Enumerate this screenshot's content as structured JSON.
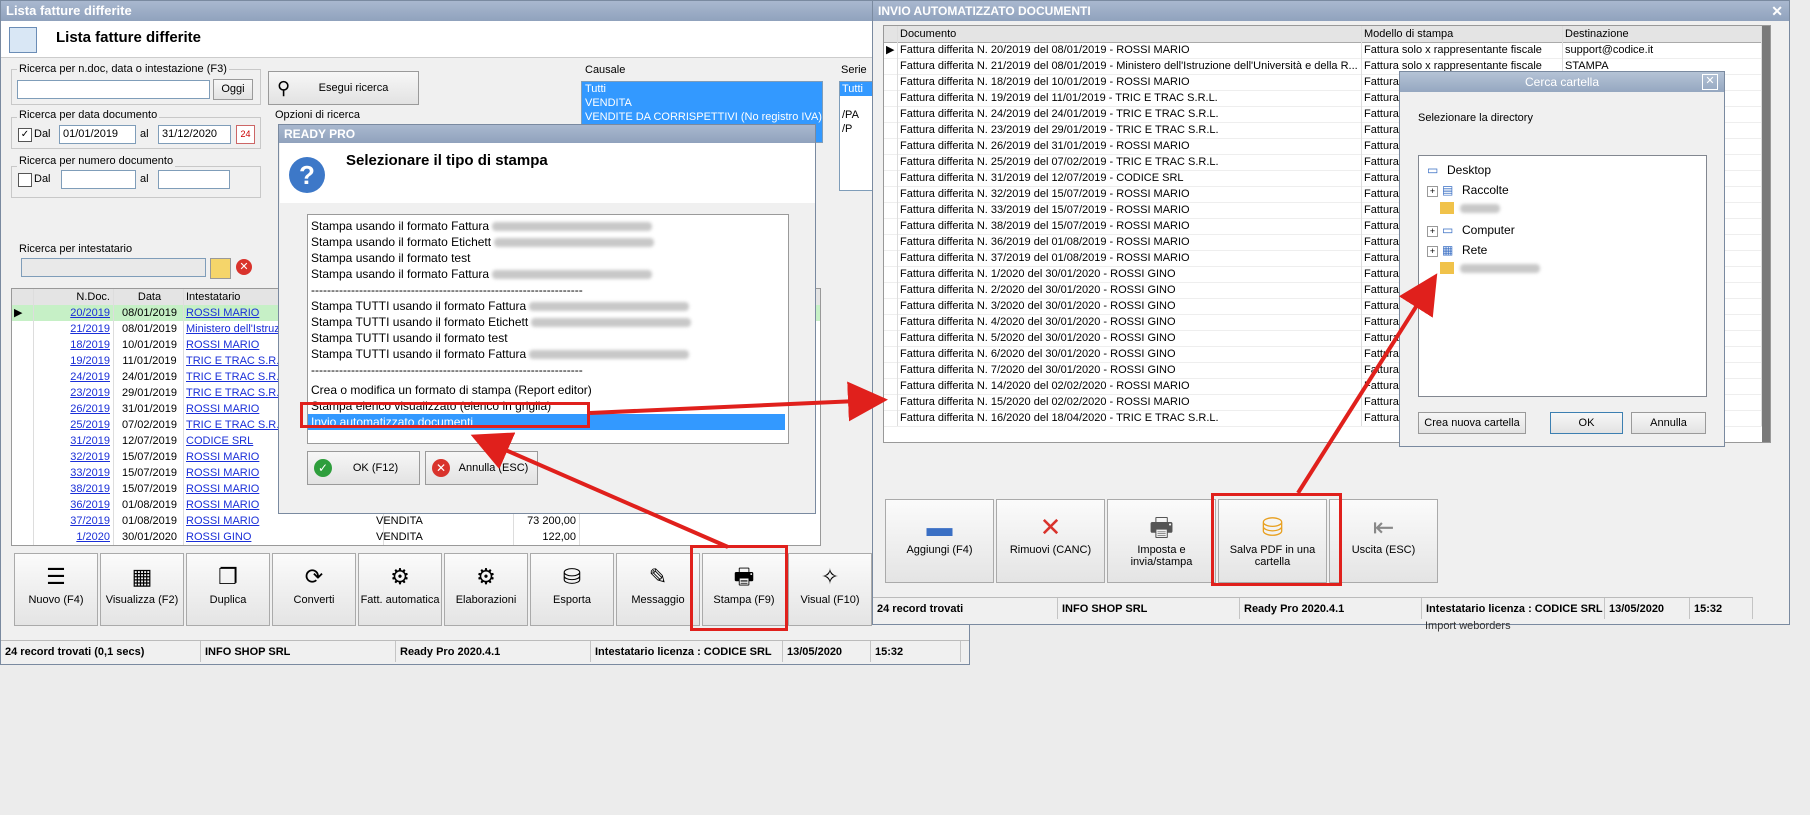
{
  "main": {
    "title": "Lista fatture differite",
    "header": "Lista fatture differite",
    "search_text_label": "Ricerca per n.doc, data o intestazione (F3)",
    "oggi": "Oggi",
    "esegui": "Esegui ricerca",
    "date_label": "Ricerca per data documento",
    "dal": "Dal",
    "date_from": "01/01/2019",
    "al": "al",
    "date_to": "31/12/2020",
    "num_label": "Ricerca per numero documento",
    "dal2": "Dal",
    "al2": "al",
    "options_label": "Opzioni di ricerca",
    "intest_label": "Ricerca per intestatario",
    "causale_label": "Causale",
    "causale_items": [
      "Tutti",
      "VENDITA",
      "VENDITE DA CORRISPETTIVI (No registro IVA)"
    ],
    "serie_label": "Serie",
    "serie_items": [
      "Tutti",
      "/PA",
      "/P"
    ],
    "columns": [
      "N.Doc.",
      "Data",
      "Intestatario"
    ],
    "rows": [
      [
        "20/2019",
        "08/01/2019",
        "ROSSI MARIO"
      ],
      [
        "21/2019",
        "08/01/2019",
        "Ministero dell'Istruzione"
      ],
      [
        "18/2019",
        "10/01/2019",
        "ROSSI MARIO"
      ],
      [
        "19/2019",
        "11/01/2019",
        "TRIC E TRAC S.R.L."
      ],
      [
        "24/2019",
        "24/01/2019",
        "TRIC E TRAC S.R.L."
      ],
      [
        "23/2019",
        "29/01/2019",
        "TRIC E TRAC S.R.L."
      ],
      [
        "26/2019",
        "31/01/2019",
        "ROSSI MARIO"
      ],
      [
        "25/2019",
        "07/02/2019",
        "TRIC E TRAC S.R.L."
      ],
      [
        "31/2019",
        "12/07/2019",
        "CODICE SRL"
      ],
      [
        "32/2019",
        "15/07/2019",
        "ROSSI MARIO"
      ],
      [
        "33/2019",
        "15/07/2019",
        "ROSSI MARIO"
      ],
      [
        "38/2019",
        "15/07/2019",
        "ROSSI MARIO"
      ],
      [
        "36/2019",
        "01/08/2019",
        "ROSSI MARIO"
      ],
      [
        "37/2019",
        "01/08/2019",
        "ROSSI MARIO"
      ],
      [
        "1/2020",
        "30/01/2020",
        "ROSSI GINO"
      ]
    ],
    "extra_rows": [
      {
        "causale": "VENDITA",
        "importo": "73 200,00"
      },
      {
        "causale": "VENDITA",
        "importo": "122,00"
      }
    ],
    "toolbar": [
      "Nuovo (F4)",
      "Visualizza (F2)",
      "Duplica",
      "Converti",
      "Fatt. automatica",
      "Elaborazioni",
      "Esporta",
      "Messaggio",
      "Stampa (F9)",
      "Visual (F10)"
    ],
    "status": [
      "24 record trovati (0,1 secs)",
      "INFO SHOP SRL",
      "Ready Pro 2020.4.1",
      "Intestatario licenza : CODICE SRL",
      "13/05/2020",
      "15:32"
    ]
  },
  "dialog": {
    "title": "READY PRO",
    "heading": "Selezionare il tipo di stampa",
    "items": [
      "Stampa usando il formato Fattura",
      "Stampa usando il formato Etichett",
      "Stampa usando il formato test",
      "Stampa usando il formato Fattura",
      "--------------------------------------------------------------------",
      "Stampa TUTTI usando il formato Fattura",
      "Stampa TUTTI usando il formato Etichett",
      "Stampa TUTTI usando il formato test",
      "Stampa TUTTI usando il formato Fattura",
      "--------------------------------------------------------------------",
      "Crea o modifica un formato di stampa (Report editor)",
      "Stampa elenco visualizzato (elenco in griglia)",
      "Invio automatizzato documenti"
    ],
    "ok": "OK (F12)",
    "cancel": "Annulla (ESC)"
  },
  "invio": {
    "title": "INVIO AUTOMATIZZATO DOCUMENTI",
    "columns": [
      "Documento",
      "Modello di stampa",
      "Destinazione"
    ],
    "rows": [
      [
        "Fattura differita N. 20/2019 del 08/01/2019 - ROSSI MARIO",
        "Fattura solo x rappresentante fiscale",
        "support@codice.it"
      ],
      [
        "Fattura differita N. 21/2019 del 08/01/2019 - Ministero dell'Istruzione dell'Università e della R...",
        "Fattura solo x rappresentante fiscale",
        "STAMPA"
      ],
      [
        "Fattura differita N. 18/2019 del 10/01/2019 - ROSSI MARIO",
        "Fattura",
        ""
      ],
      [
        "Fattura differita N. 19/2019 del 11/01/2019 - TRIC E TRAC S.R.L.",
        "Fattura",
        ""
      ],
      [
        "Fattura differita N. 24/2019 del 24/01/2019 - TRIC E TRAC S.R.L.",
        "Fattura",
        ""
      ],
      [
        "Fattura differita N. 23/2019 del 29/01/2019 - TRIC E TRAC S.R.L.",
        "Fattura",
        ""
      ],
      [
        "Fattura differita N. 26/2019 del 31/01/2019 - ROSSI MARIO",
        "Fattura",
        ""
      ],
      [
        "Fattura differita N. 25/2019 del 07/02/2019 - TRIC E TRAC S.R.L.",
        "Fattura",
        ""
      ],
      [
        "Fattura differita N. 31/2019 del 12/07/2019 - CODICE SRL",
        "Fattura",
        ""
      ],
      [
        "Fattura differita N. 32/2019 del 15/07/2019 - ROSSI MARIO",
        "Fattura",
        ""
      ],
      [
        "Fattura differita N. 33/2019 del 15/07/2019 - ROSSI MARIO",
        "Fattura",
        ""
      ],
      [
        "Fattura differita N. 38/2019 del 15/07/2019 - ROSSI MARIO",
        "Fattura",
        ""
      ],
      [
        "Fattura differita N. 36/2019 del 01/08/2019 - ROSSI MARIO",
        "Fattura",
        ""
      ],
      [
        "Fattura differita N. 37/2019 del 01/08/2019 - ROSSI MARIO",
        "Fattura",
        ""
      ],
      [
        "Fattura differita N. 1/2020 del 30/01/2020 - ROSSI GINO",
        "Fattura",
        ""
      ],
      [
        "Fattura differita N. 2/2020 del 30/01/2020 - ROSSI GINO",
        "Fattura",
        ""
      ],
      [
        "Fattura differita N. 3/2020 del 30/01/2020 - ROSSI GINO",
        "Fattura",
        ""
      ],
      [
        "Fattura differita N. 4/2020 del 30/01/2020 - ROSSI GINO",
        "Fattura",
        ""
      ],
      [
        "Fattura differita N. 5/2020 del 30/01/2020 - ROSSI GINO",
        "Fattura",
        ""
      ],
      [
        "Fattura differita N. 6/2020 del 30/01/2020 - ROSSI GINO",
        "Fattura",
        ""
      ],
      [
        "Fattura differita N. 7/2020 del 30/01/2020 - ROSSI GINO",
        "Fattura",
        ""
      ],
      [
        "Fattura differita N. 14/2020 del 02/02/2020 - ROSSI MARIO",
        "Fattura",
        ""
      ],
      [
        "Fattura differita N. 15/2020 del 02/02/2020 - ROSSI MARIO",
        "Fattura",
        ""
      ],
      [
        "Fattura differita N. 16/2020 del 18/04/2020 - TRIC E TRAC S.R.L.",
        "Fattura",
        ""
      ]
    ],
    "buttons": [
      "Aggiungi (F4)",
      "Rimuovi (CANC)",
      "Imposta e invia/stampa",
      "Salva PDF in una cartella",
      "Uscita (ESC)"
    ],
    "status": [
      "24 record trovati",
      "INFO SHOP SRL",
      "Ready Pro 2020.4.1",
      "Intestatario licenza : CODICE SRL",
      "13/05/2020",
      "15:32"
    ],
    "footer_note": "Import weborders"
  },
  "folder": {
    "title": "Cerca cartella",
    "prompt": "Selezionare la directory",
    "tree": [
      "Desktop",
      "Raccolte",
      "Computer",
      "Rete"
    ],
    "new_folder": "Crea nuova cartella",
    "ok": "OK",
    "cancel": "Annulla"
  },
  "colors": {
    "accent": "#3399ff",
    "highlight": "#e0201c",
    "selected_row": "#c6f0c6"
  }
}
